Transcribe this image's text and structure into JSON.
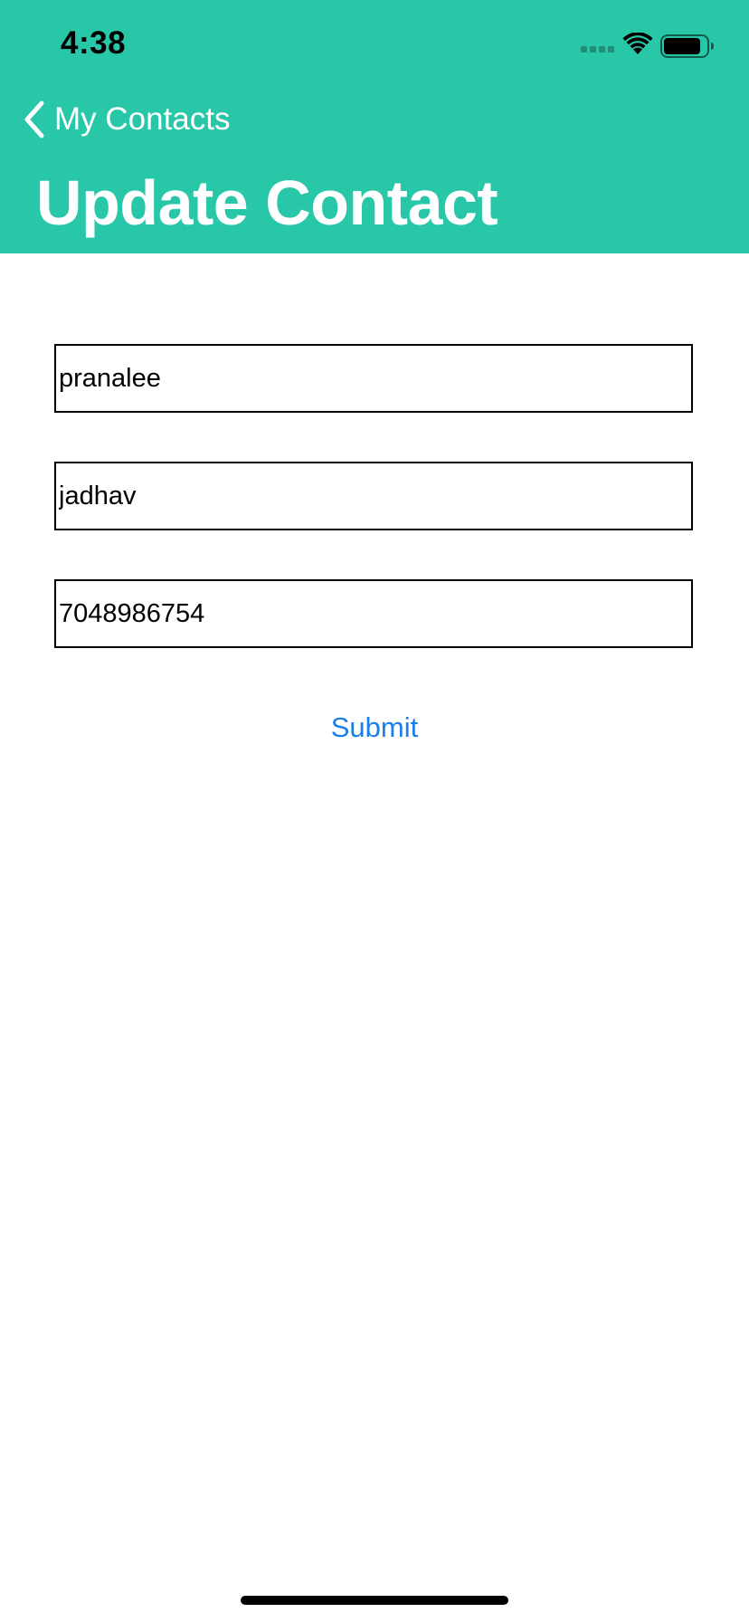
{
  "status_bar": {
    "time": "4:38"
  },
  "nav": {
    "back_label": "My Contacts",
    "title": "Update Contact"
  },
  "form": {
    "first_name": "pranalee",
    "last_name": "jadhav",
    "phone": "7048986754",
    "submit_label": "Submit"
  },
  "colors": {
    "header_bg": "#28c7a8",
    "link": "#1a7fe8"
  },
  "icons": {
    "back": "chevron-left-icon",
    "signal": "cellular-signal-icon",
    "wifi": "wifi-icon",
    "battery": "battery-icon"
  }
}
